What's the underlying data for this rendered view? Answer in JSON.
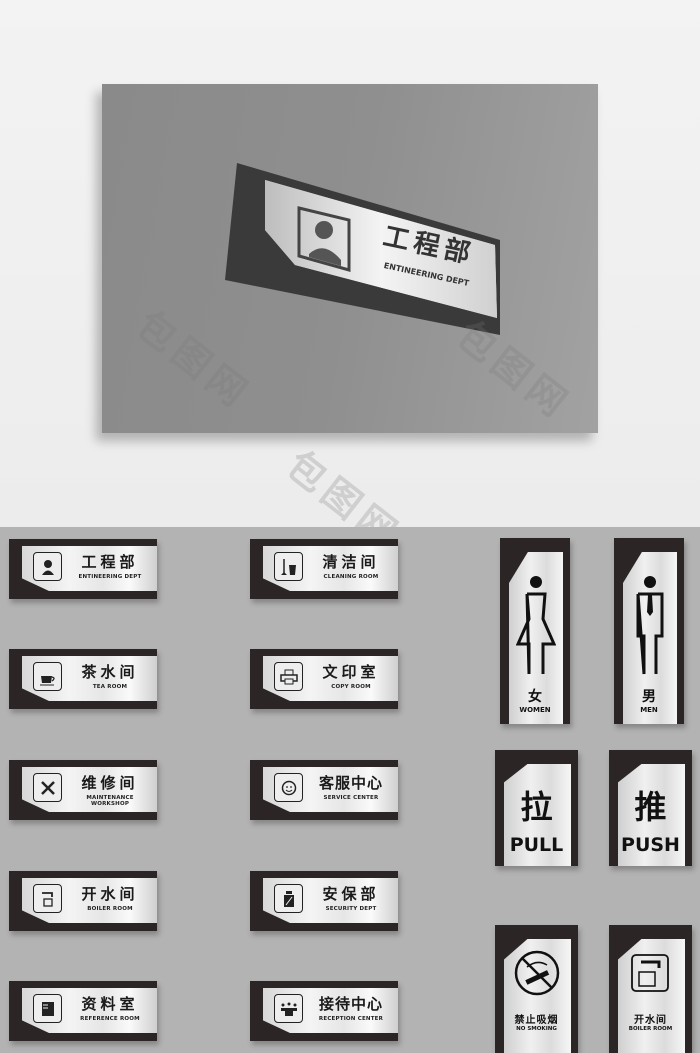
{
  "mockup": {
    "title_cn": "工程部",
    "title_en": "ENTINEERING DEPT",
    "icon": "engineer-helmet-icon"
  },
  "signs": [
    {
      "cn": "工程部",
      "en": "ENTINEERING DEPT",
      "icon": "engineer-helmet-icon"
    },
    {
      "cn": "清洁间",
      "en": "CLEANING ROOM",
      "icon": "mop-bucket-icon"
    },
    {
      "cn": "茶水间",
      "en": "TEA ROOM",
      "icon": "coffee-cup-icon"
    },
    {
      "cn": "文印室",
      "en": "COPY ROOM",
      "icon": "printer-icon"
    },
    {
      "cn": "维修间",
      "en": "MAINTENANCE WORKSHOP",
      "icon": "wrench-screwdriver-icon"
    },
    {
      "cn": "客服中心",
      "en": "SERVICE CENTER",
      "icon": "headset-smiley-icon"
    },
    {
      "cn": "开水间",
      "en": "BOILER ROOM",
      "icon": "faucet-cup-icon"
    },
    {
      "cn": "安保部",
      "en": "SECURITY DEPT",
      "icon": "security-badge-icon"
    },
    {
      "cn": "资料室",
      "en": "REFERENCE ROOM",
      "icon": "file-folder-icon"
    },
    {
      "cn": "接待中心",
      "en": "RECEPTION CENTER",
      "icon": "meeting-people-icon"
    }
  ],
  "restrooms": [
    {
      "cn": "女",
      "en": "WOMEN",
      "icon": "woman-figure-icon"
    },
    {
      "cn": "男",
      "en": "MEN",
      "icon": "man-figure-icon"
    }
  ],
  "doors": [
    {
      "cn": "拉",
      "en": "PULL"
    },
    {
      "cn": "推",
      "en": "PUSH"
    }
  ],
  "notices": [
    {
      "cn": "禁止吸烟",
      "en": "NO SMOKING",
      "icon": "no-smoking-icon"
    },
    {
      "cn": "开水间",
      "en": "BOILER ROOM",
      "icon": "faucet-cup-icon"
    }
  ],
  "watermark": "包图网"
}
